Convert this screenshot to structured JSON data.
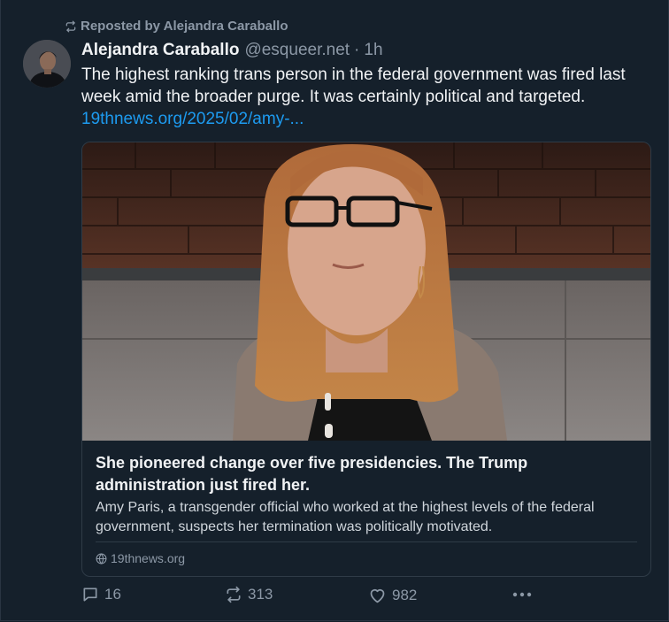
{
  "repost": {
    "label": "Reposted by Alejandra Caraballo",
    "icon": "repost-icon"
  },
  "post": {
    "author_name": "Alejandra Caraballo",
    "handle": "@esqueer.net",
    "separator": "·",
    "time": "1h",
    "text": "The highest ranking trans person in the federal government was fired last week amid the broader purge. It was certainly political and targeted.",
    "link": "19thnews.org/2025/02/amy-..."
  },
  "card": {
    "title": "She pioneered change over five presidencies. The Trump administration just fired her.",
    "description": "Amy Paris, a transgender official who worked at the highest levels of the federal government, suspects her termination was politically motivated.",
    "source": "19thnews.org",
    "source_icon": "globe-icon"
  },
  "actions": {
    "replies": "16",
    "reposts": "313",
    "likes": "982",
    "reply_icon": "reply-icon",
    "repost_icon": "repost-icon",
    "like_icon": "heart-icon",
    "more_icon": "more-icon"
  },
  "colors": {
    "background": "#15202b",
    "link": "#1d9bf0",
    "muted": "#8c98a6",
    "text": "#f1f3f5",
    "border": "#2f3b47"
  }
}
